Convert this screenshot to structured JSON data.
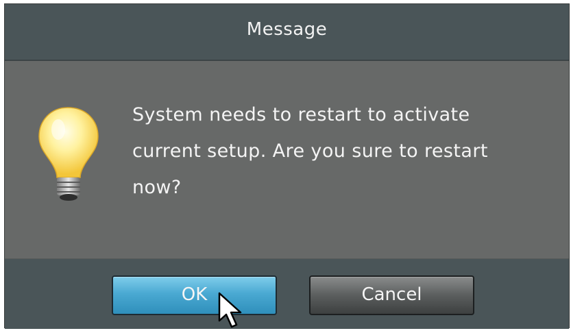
{
  "dialog": {
    "title": "Message",
    "message_line1": "System needs to restart to activate",
    "message_line2": "current setup. Are you sure to restart",
    "message_line3": "now?",
    "icon": "lightbulb-icon"
  },
  "buttons": {
    "ok_label": "OK",
    "cancel_label": "Cancel"
  },
  "colors": {
    "titlebar": "#4a5558",
    "body": "#676968",
    "ok_accent": "#4aa9d2",
    "cancel": "#5b5e5e"
  }
}
